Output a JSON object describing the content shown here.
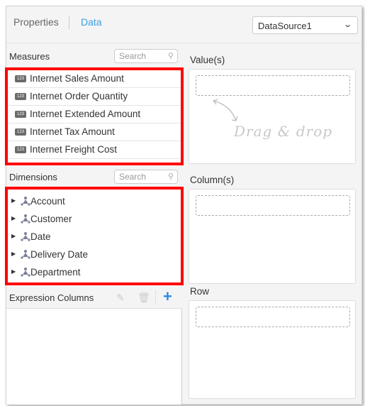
{
  "header": {
    "tabs": [
      {
        "label": "Properties",
        "active": false
      },
      {
        "label": "Data",
        "active": true
      }
    ],
    "datasource": "DataSource1"
  },
  "measures": {
    "title": "Measures",
    "search_placeholder": "Search",
    "items": [
      "Internet Sales Amount",
      "Internet Order Quantity",
      "Internet Extended Amount",
      "Internet Tax Amount",
      "Internet Freight Cost"
    ],
    "icon_text": "123"
  },
  "dimensions": {
    "title": "Dimensions",
    "search_placeholder": "Search",
    "items": [
      "Account",
      "Customer",
      "Date",
      "Delivery Date",
      "Department"
    ]
  },
  "expression": {
    "title": "Expression Columns"
  },
  "right": {
    "values_label": "Value(s)",
    "columns_label": "Column(s)",
    "row_label": "Row",
    "hint": "Drag & drop"
  },
  "colors": {
    "accent": "#3aa0e0",
    "highlight": "#ff0000"
  }
}
